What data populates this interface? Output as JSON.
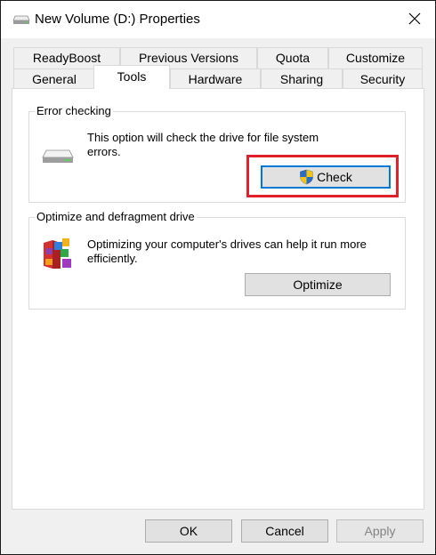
{
  "window": {
    "title": "New Volume (D:) Properties",
    "icons": {
      "title": "drive-icon",
      "close": "close-icon"
    }
  },
  "tabs": {
    "row1": [
      "ReadyBoost",
      "Previous Versions",
      "Quota",
      "Customize"
    ],
    "row2": [
      "General",
      "Tools",
      "Hardware",
      "Sharing",
      "Security"
    ],
    "active": "Tools"
  },
  "error_checking": {
    "label": "Error checking",
    "description": "This option will check the drive for file system errors.",
    "button": "Check",
    "icons": {
      "drive": "drive-icon",
      "shield": "uac-shield-icon"
    }
  },
  "optimize": {
    "label": "Optimize and defragment drive",
    "description": "Optimizing your computer's drives can help it run more efficiently.",
    "button": "Optimize",
    "icons": {
      "defrag": "defrag-icon"
    }
  },
  "footer": {
    "ok": "OK",
    "cancel": "Cancel",
    "apply": "Apply"
  },
  "colors": {
    "highlight": "#e0202a",
    "focus": "#0078d7",
    "panel": "#ffffff",
    "background": "#f0f0f0"
  }
}
